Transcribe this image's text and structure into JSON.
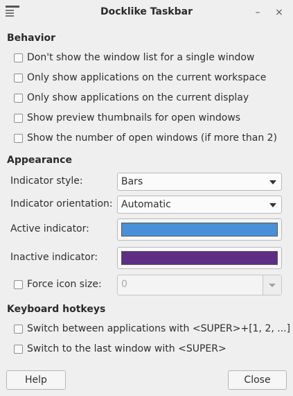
{
  "window": {
    "title": "Docklike Taskbar",
    "minimize_glyph": "–",
    "close_glyph": "×"
  },
  "behavior": {
    "title": "Behavior",
    "options": [
      {
        "label": "Don't show the window list for a single window",
        "checked": false
      },
      {
        "label": "Only show applications on the current workspace",
        "checked": false
      },
      {
        "label": "Only show applications on the current display",
        "checked": false
      },
      {
        "label": "Show preview thumbnails for open windows",
        "checked": false
      },
      {
        "label": "Show the number of open windows (if more than 2)",
        "checked": false
      }
    ]
  },
  "appearance": {
    "title": "Appearance",
    "indicator_style": {
      "label": "Indicator style:",
      "value": "Bars"
    },
    "indicator_orientation": {
      "label": "Indicator orientation:",
      "value": "Automatic"
    },
    "active_indicator": {
      "label": "Active indicator:",
      "color": "#4a90d9"
    },
    "inactive_indicator": {
      "label": "Inactive indicator:",
      "color": "#5e2d84"
    },
    "force_icon_size": {
      "label": "Force icon size:",
      "checked": false,
      "value": "0"
    }
  },
  "hotkeys": {
    "title": "Keyboard hotkeys",
    "options": [
      {
        "label": "Switch between applications with <SUPER>+[1, 2, ...]",
        "checked": false
      },
      {
        "label": "Switch to the last window with <SUPER>",
        "checked": false
      }
    ]
  },
  "buttons": {
    "help": "Help",
    "close": "Close"
  }
}
